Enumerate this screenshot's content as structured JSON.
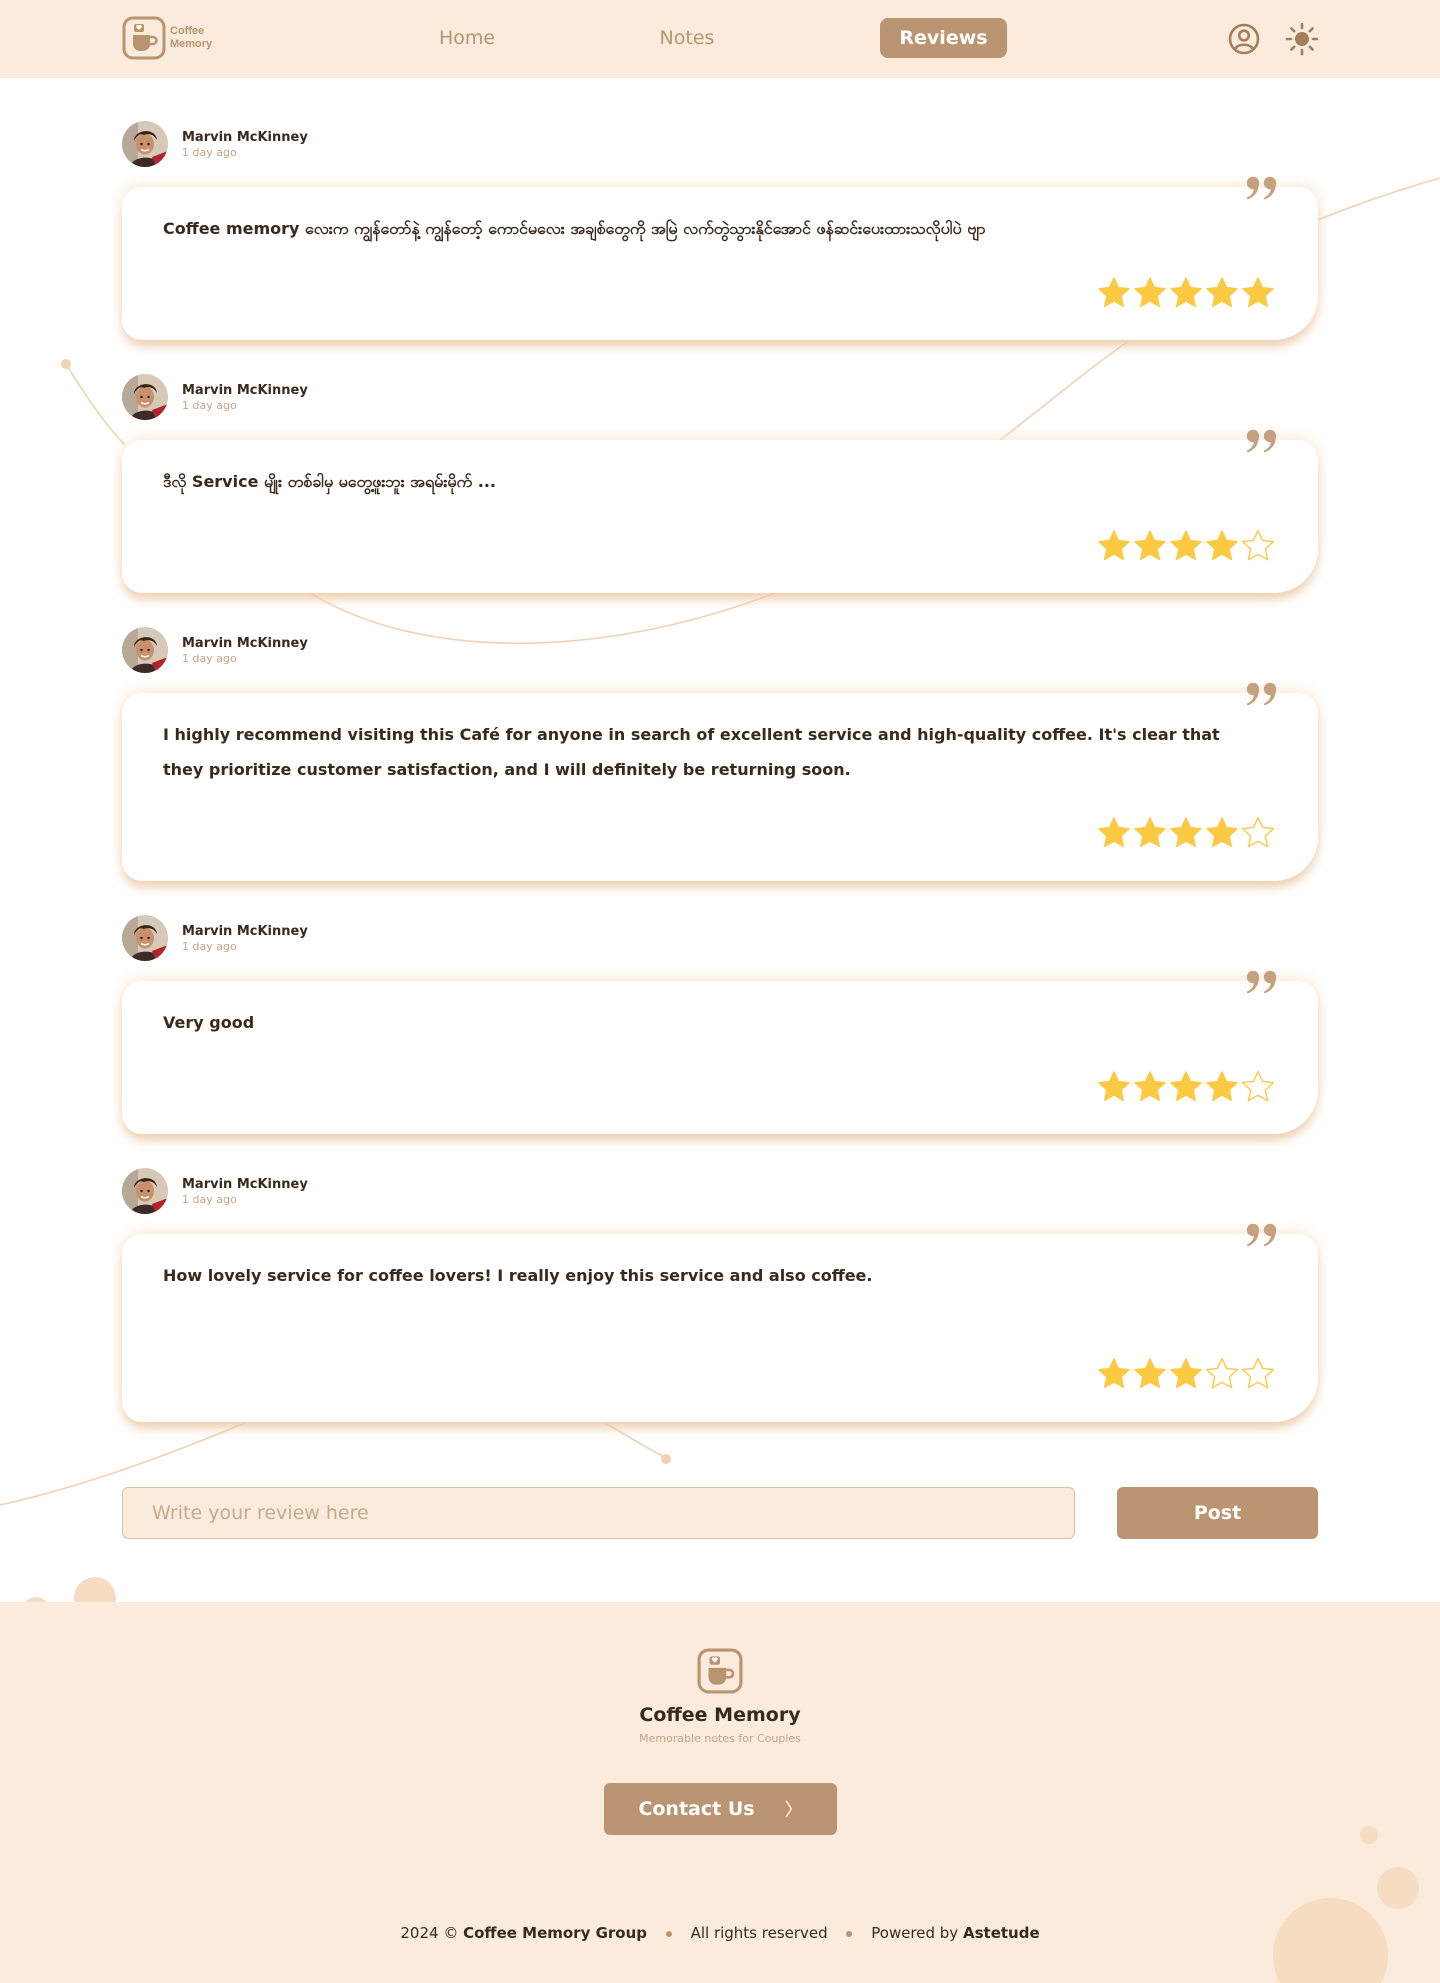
{
  "brand": {
    "name_line1": "Coffee",
    "name_line2": "Memory"
  },
  "nav": {
    "home": "Home",
    "notes": "Notes",
    "reviews": "Reviews",
    "active": "Reviews"
  },
  "icons": {
    "user": "user-circle-icon",
    "theme": "sun-icon",
    "quote": "quote-icon",
    "star": "star-icon",
    "chevron": "chevron-right-icon"
  },
  "colors": {
    "brand": "#bb9572",
    "cream": "#faebdc",
    "star": "#fcc942",
    "text": "#3a2a1c"
  },
  "reviews": [
    {
      "name": "Marvin McKinney",
      "time": "1 day ago",
      "text": "Coffee memory လေးက ကျွန်တော်နဲ့ ကျွန်တော့် ကောင်မလေး အချစ်တွေကို အမြဲ လက်တွဲသွားနိုင်အောင် ဖန်ဆင်းပေးထားသလိုပါပဲ ဗျာ",
      "rating": 5
    },
    {
      "name": "Marvin McKinney",
      "time": "1 day ago",
      "text": "ဒီလို Service မျိုး တစ်ခါမှ မတွေ့ဖူးဘူး အရမ်းမိုက် ...",
      "rating": 4
    },
    {
      "name": "Marvin McKinney",
      "time": "1 day ago",
      "text": "I highly recommend visiting this Café for anyone in search of excellent service and high-quality coffee. It's clear that they prioritize customer satisfaction, and I will definitely be returning soon.",
      "rating": 4
    },
    {
      "name": "Marvin McKinney",
      "time": "1 day ago",
      "text": "Very good",
      "rating": 4
    },
    {
      "name": "Marvin McKinney",
      "time": "1 day ago",
      "text": "How lovely service for coffee lovers! I really enjoy this service and also coffee.",
      "rating": 3
    }
  ],
  "composer": {
    "placeholder": "Write your review here",
    "post_label": "Post"
  },
  "footer": {
    "title": "Coffee Memory",
    "tagline": "Memorable notes for Couples",
    "contact_label": "Contact Us",
    "year": "2024 ©",
    "group": "Coffee Memory Group",
    "rights": "All rights reserved",
    "powered_prefix": "Powered by",
    "powered_name": "Astetude"
  }
}
